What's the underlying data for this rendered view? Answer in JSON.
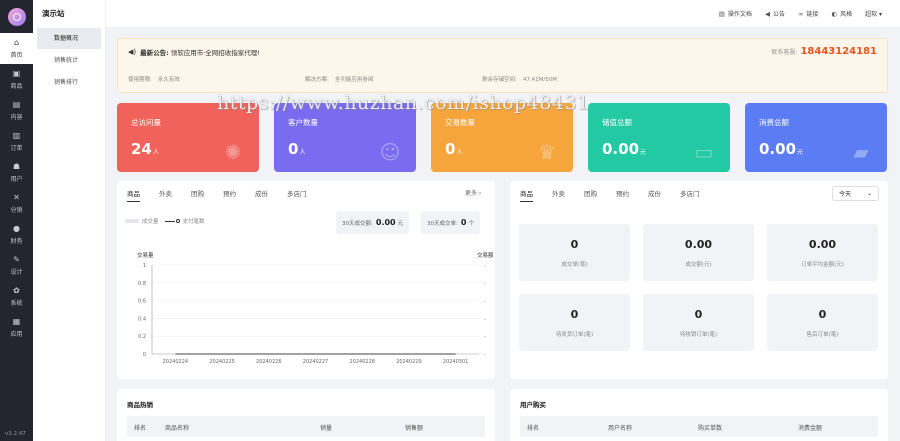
{
  "app": {
    "site_name": "演示站",
    "version": "v3.2.47"
  },
  "sidebar": {
    "items": [
      {
        "label": "首页",
        "icon": "home-icon",
        "active": true
      },
      {
        "label": "商品",
        "icon": "goods-icon"
      },
      {
        "label": "内容",
        "icon": "content-icon"
      },
      {
        "label": "订单",
        "icon": "order-icon"
      },
      {
        "label": "用户",
        "icon": "user-icon"
      },
      {
        "label": "分销",
        "icon": "share-icon"
      },
      {
        "label": "财务",
        "icon": "finance-icon"
      },
      {
        "label": "设计",
        "icon": "design-icon"
      },
      {
        "label": "系统",
        "icon": "gear-icon"
      },
      {
        "label": "应用",
        "icon": "apps-icon"
      }
    ]
  },
  "submenu": {
    "items": [
      {
        "label": "数据概况",
        "active": true
      },
      {
        "label": "销售统计"
      },
      {
        "label": "销售排行"
      }
    ]
  },
  "header": {
    "links": [
      {
        "label": "操作文档",
        "icon": "doc-icon"
      },
      {
        "label": "公告",
        "icon": "speaker-icon"
      },
      {
        "label": "链接",
        "icon": "link-icon"
      },
      {
        "label": "风格",
        "icon": "palette-icon"
      }
    ],
    "user": "超软 ▾"
  },
  "notice": {
    "title": "最新公告:",
    "text": "领软应用市·全网招收指家代理!",
    "phone_label": "联系客服:",
    "phone": "18443124181",
    "info": [
      {
        "label": "使用期限:",
        "value": "永久有效"
      },
      {
        "label": "解决方案:",
        "value": "全功能应用参阅"
      },
      {
        "label": "剩余存储空间:",
        "value": "47.41M/50M"
      }
    ]
  },
  "stats": [
    {
      "label": "总访问量",
      "value": "24",
      "unit": "人",
      "color": "#f0625b",
      "icon": "paw-icon"
    },
    {
      "label": "客户数量",
      "value": "0",
      "unit": "人",
      "color": "#7a6cf0",
      "icon": "customer-icon"
    },
    {
      "label": "交易数量",
      "value": "0",
      "unit": "人",
      "color": "#f5a53c",
      "icon": "crown-icon"
    },
    {
      "label": "储值总额",
      "value": "0.00",
      "unit": "元",
      "color": "#22c9a3",
      "icon": "card-icon"
    },
    {
      "label": "消费总额",
      "value": "0.00",
      "unit": "元",
      "color": "#5b7cf2",
      "icon": "wallet-icon"
    }
  ],
  "left_panel": {
    "tabs": [
      "商品",
      "外卖",
      "团购",
      "预约",
      "成份",
      "多店门"
    ],
    "more": "更多 ›",
    "legend": [
      "成交量",
      "支付笔数"
    ],
    "pill1_label": "30天成交额:",
    "pill1_value": "0.00",
    "pill1_unit": "元",
    "pill2_label": "30天成交单:",
    "pill2_value": "0",
    "pill2_unit": "个"
  },
  "chart_data": {
    "type": "line",
    "x": [
      "20240224",
      "20240225",
      "20240226",
      "20240227",
      "20240228",
      "20240229",
      "20240301"
    ],
    "series": [
      {
        "name": "成交量",
        "values": [
          0,
          0,
          0,
          0,
          0,
          0,
          0
        ]
      },
      {
        "name": "支付笔数",
        "values": [
          0,
          0,
          0,
          0,
          0,
          0,
          0
        ]
      }
    ],
    "ylabel": "交易量",
    "ylabel_right": "交易额",
    "yticks": [
      "1",
      "0.8",
      "0.6",
      "0.4",
      "0.2",
      "0"
    ],
    "ylim": [
      0,
      1
    ],
    "grid": true,
    "legend": "top-left"
  },
  "right_panel": {
    "tabs": [
      "商品",
      "外卖",
      "团购",
      "预约",
      "成份",
      "多店门"
    ],
    "select": "今天",
    "stats": [
      {
        "value": "0",
        "label": "成交单(笔)"
      },
      {
        "value": "0.00",
        "label": "成交额(元)"
      },
      {
        "value": "0.00",
        "label": "订单平均金额(元)"
      },
      {
        "value": "0",
        "label": "待发货订单(笔)"
      },
      {
        "value": "0",
        "label": "待核销订单(笔)"
      },
      {
        "value": "0",
        "label": "售后订单(笔)"
      }
    ]
  },
  "hot_goods": {
    "title": "商品热销",
    "headers": [
      "排名",
      "商品名称",
      "销量",
      "销售额"
    ]
  },
  "user_buy": {
    "title": "用户购买",
    "headers": [
      "排名",
      "用户名称",
      "购买单数",
      "消费金额"
    ]
  },
  "watermark": "https://www.huzhan.com/ishop48431"
}
